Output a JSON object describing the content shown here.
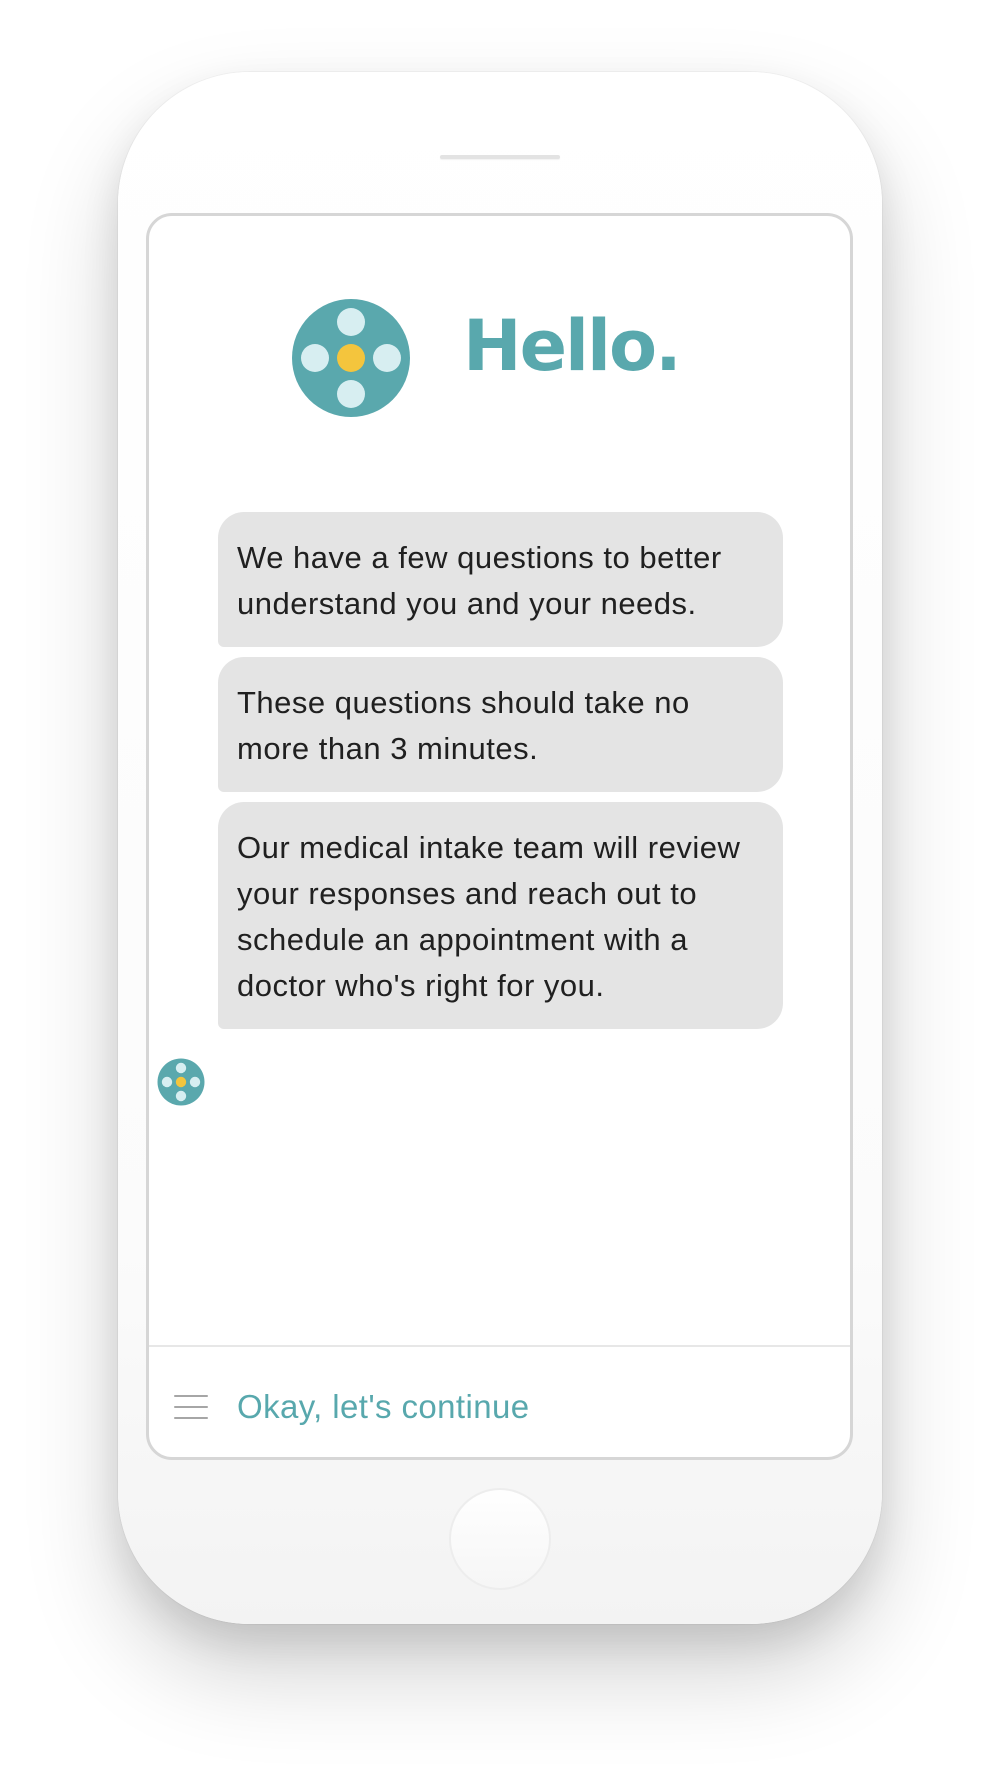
{
  "hero": {
    "title": "Hello."
  },
  "messages": [
    "We have a few questions to better understand you and your needs.",
    "These questions should take no more than 3 minutes.",
    "Our medical intake team will review your responses and reach out to schedule an appointment with a doctor who's right for you."
  ],
  "footer": {
    "reply_label": "Okay, let's continue"
  },
  "icons": {
    "logo": "medical-cross-logo-icon",
    "assistant_avatar": "assistant-avatar-icon",
    "menu": "menu-icon"
  },
  "colors": {
    "brand_teal": "#5aa8ad",
    "brand_light_dot": "#d7eef1",
    "brand_yellow": "#f4c53d",
    "bubble_background": "#e4e4e4",
    "text_dark": "#202020",
    "menu_gray": "#a6a6a6"
  }
}
